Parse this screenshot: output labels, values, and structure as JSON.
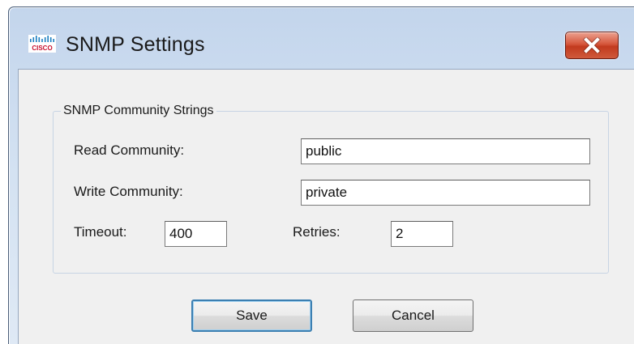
{
  "window": {
    "title": "SNMP Settings",
    "logo_icon": "cisco-logo",
    "logo_text": "CISCO",
    "close_icon": "close-icon",
    "close_color": "#c94a2c"
  },
  "group": {
    "legend": "SNMP Community Strings",
    "read_community": {
      "label": "Read Community:",
      "value": "public"
    },
    "write_community": {
      "label": "Write Community:",
      "value": "private"
    },
    "timeout": {
      "label": "Timeout:",
      "value": "400"
    },
    "retries": {
      "label": "Retries:",
      "value": "2"
    }
  },
  "buttons": {
    "save": "Save",
    "cancel": "Cancel"
  },
  "colors": {
    "frame": "#c3d5ec",
    "client_bg": "#f0f0f0",
    "default_button_border": "#3c7fb1"
  }
}
